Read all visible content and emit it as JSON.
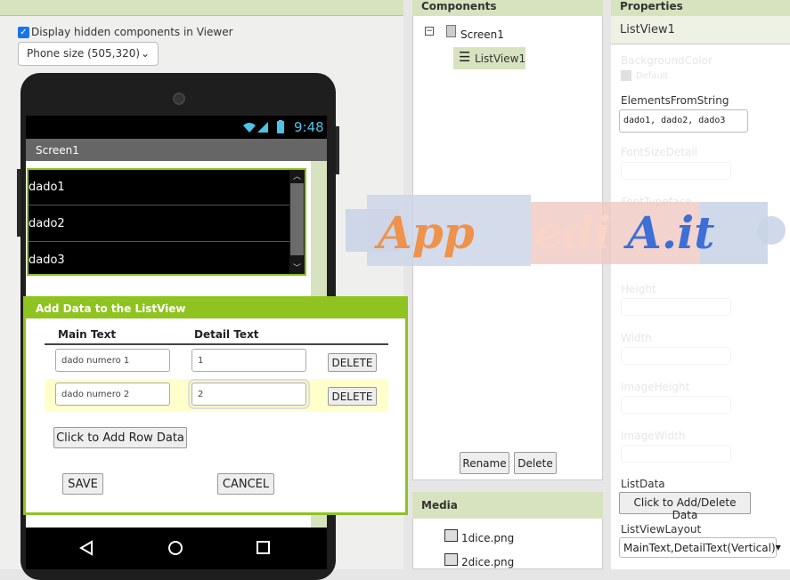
{
  "viewer": {
    "checkbox_label": "Display hidden components in Viewer",
    "phone_size": "Phone size (505,320)",
    "status_time": "9:48",
    "screen_title": "Screen1",
    "listview_items": [
      "dado1",
      "dado2",
      "dado3"
    ]
  },
  "dialog": {
    "title": "Add Data to the ListView",
    "col_main": "Main Text",
    "col_detail": "Detail Text",
    "rows": [
      {
        "main": "dado numero 1",
        "detail": "1",
        "delete": "DELETE"
      },
      {
        "main": "dado numero 2",
        "detail": "2",
        "delete": "DELETE"
      }
    ],
    "add_row": "Click to Add Row Data",
    "save": "SAVE",
    "cancel": "CANCEL"
  },
  "components": {
    "header": "Components",
    "tree": [
      "Screen1",
      "ListView1"
    ],
    "rename": "Rename",
    "delete": "Delete"
  },
  "media": {
    "header": "Media",
    "files": [
      "1dice.png",
      "2dice.png"
    ]
  },
  "properties": {
    "header": "Properties",
    "selected": "ListView1",
    "background_color_label": "BackgroundColor",
    "background_color_value": "Default",
    "elements_label": "ElementsFromString",
    "elements_value": "dado1, dado2, dado3",
    "font_size_label": "FontSizeDetail",
    "font_typeface_label": "FontTypeface",
    "height_label": "Height",
    "width_label": "Width",
    "image_height_label": "ImageHeight",
    "image_width_label": "ImageWidth",
    "listdata_label": "ListData",
    "listdata_button": "Click to Add/Delete Data",
    "layout_label": "ListViewLayout",
    "layout_value": "MainText,DetailText(Vertical)"
  },
  "watermark": "AppediA.it",
  "colors": {
    "accent": "#8fc31f",
    "panel_header": "#d7e3bf",
    "status_blue": "#4ec3e8"
  }
}
